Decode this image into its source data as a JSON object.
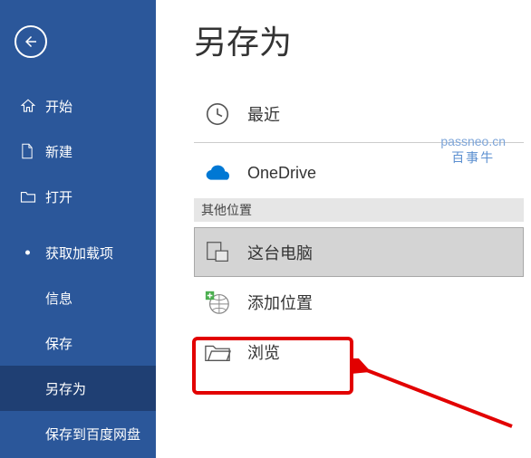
{
  "sidebar": {
    "back_icon": "back-arrow",
    "items": [
      {
        "icon": "home-icon",
        "label": "开始"
      },
      {
        "icon": "new-file-icon",
        "label": "新建"
      },
      {
        "icon": "open-folder-icon",
        "label": "打开"
      }
    ],
    "sub_items": [
      {
        "label": "获取加载项",
        "bullet": true
      },
      {
        "label": "信息"
      },
      {
        "label": "保存"
      },
      {
        "label": "另存为",
        "active": true
      },
      {
        "label": "保存到百度网盘"
      }
    ]
  },
  "main": {
    "title": "另存为",
    "section_header": "其他位置",
    "locations": [
      {
        "icon": "clock-icon",
        "label": "最近"
      },
      {
        "icon": "onedrive-icon",
        "label": "OneDrive"
      },
      {
        "icon": "this-pc-icon",
        "label": "这台电脑",
        "selected": true
      },
      {
        "icon": "add-location-icon",
        "label": "添加位置"
      },
      {
        "icon": "browse-folder-icon",
        "label": "浏览",
        "highlighted": true
      }
    ]
  },
  "watermark": {
    "line1": "passneo.cn",
    "line2": "百事牛"
  },
  "colors": {
    "sidebar": "#2b579a",
    "highlight": "#e20000"
  }
}
